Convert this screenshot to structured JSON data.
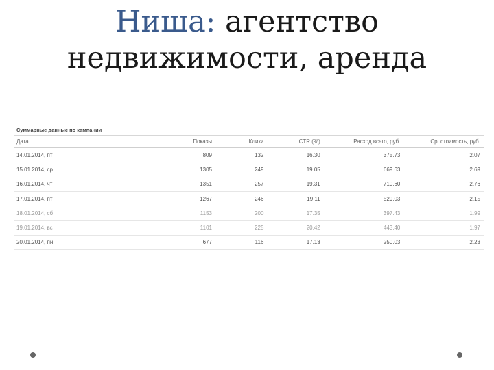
{
  "title": {
    "accent": "Ниша:",
    "rest_line1": "агентство",
    "line2": "недвижимости, аренда"
  },
  "report": {
    "caption": "Суммарные данные по кампании",
    "columns": [
      "Дата",
      "Показы",
      "Клики",
      "CTR (%)",
      "Расход всего, руб.",
      "Ср. стоимость, руб."
    ],
    "rows": [
      {
        "date": "14.01.2014, пт",
        "shows": "809",
        "clicks": "132",
        "ctr": "16.30",
        "spend": "375.73",
        "cpc": "2.07"
      },
      {
        "date": "15.01.2014, ср",
        "shows": "1305",
        "clicks": "249",
        "ctr": "19.05",
        "spend": "669.63",
        "cpc": "2.69"
      },
      {
        "date": "16.01.2014, чт",
        "shows": "1351",
        "clicks": "257",
        "ctr": "19.31",
        "spend": "710.60",
        "cpc": "2.76"
      },
      {
        "date": "17.01.2014, пт",
        "shows": "1267",
        "clicks": "246",
        "ctr": "19.11",
        "spend": "529.03",
        "cpc": "2.15"
      },
      {
        "date": "18.01.2014, сб",
        "shows": "1153",
        "clicks": "200",
        "ctr": "17.35",
        "spend": "397.43",
        "cpc": "1.99"
      },
      {
        "date": "19.01.2014, вс",
        "shows": "1101",
        "clicks": "225",
        "ctr": "20.42",
        "spend": "443.40",
        "cpc": "1.97"
      },
      {
        "date": "20.01.2014, пн",
        "shows": "677",
        "clicks": "116",
        "ctr": "17.13",
        "spend": "250.03",
        "cpc": "2.23"
      }
    ]
  }
}
